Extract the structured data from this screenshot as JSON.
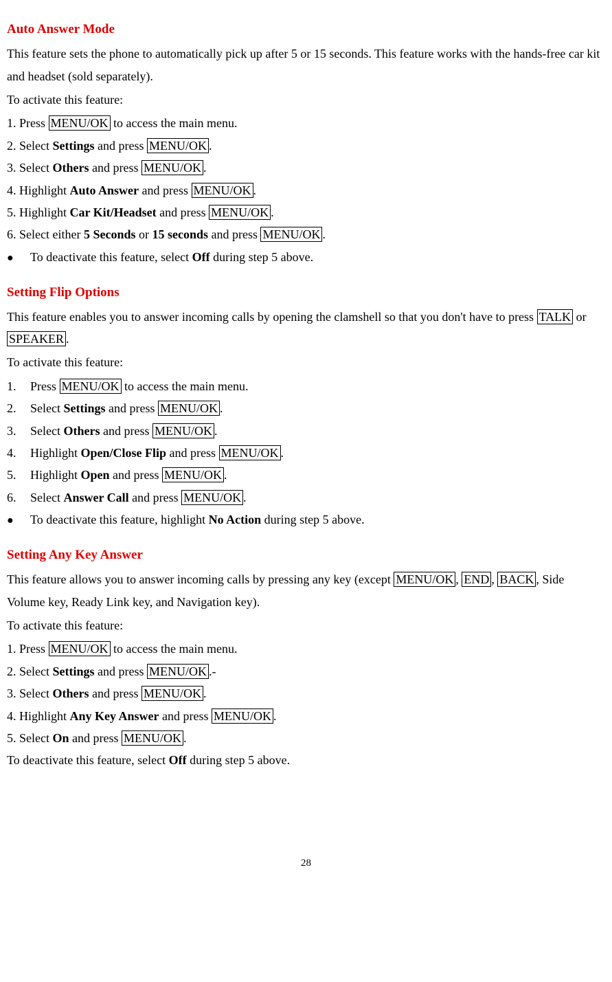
{
  "section1": {
    "heading": "Auto Answer Mode",
    "intro": "This feature sets the phone to automatically pick up after 5 or 15 seconds. This feature works with the hands-free car kit and headset (sold separately).",
    "activate": "To activate this feature:",
    "step1_pre": "1. Press ",
    "step1_key": "MENU/OK",
    "step1_post": " to access the main menu.",
    "step2_pre": "2. Select ",
    "step2_bold": "Settings",
    "step2_mid": " and press ",
    "step2_key": "MENU/OK",
    "step2_post": ".",
    "step3_pre": "3. Select ",
    "step3_bold": "Others",
    "step3_mid": " and press ",
    "step3_key": "MENU/OK",
    "step3_post": ".",
    "step4_pre": "4. Highlight ",
    "step4_bold": "Auto Answer",
    "step4_mid": " and press ",
    "step4_key": "MENU/OK",
    "step4_post": ".",
    "step5_pre": "5. Highlight ",
    "step5_bold": "Car Kit/Headset",
    "step5_mid": " and press ",
    "step5_key": "MENU/OK",
    "step5_post": ".",
    "step6_pre": "6. Select either ",
    "step6_bold1": "5 Seconds",
    "step6_mid1": " or ",
    "step6_bold2": "15 seconds",
    "step6_mid2": " and press ",
    "step6_key": "MENU/OK",
    "step6_post": ".",
    "bullet_pre": "To deactivate this feature, select ",
    "bullet_bold": "Off",
    "bullet_post": " during step 5 above."
  },
  "section2": {
    "heading": "Setting Flip Options",
    "intro_pre": "This feature enables you to answer incoming calls by opening the clamshell so that you don't have to press ",
    "intro_key1": "TALK",
    "intro_mid": " or ",
    "intro_key2": "SPEAKER",
    "intro_post": ".",
    "activate": "To activate this feature:",
    "step1_num": "1.",
    "step1_pre": "Press ",
    "step1_key": "MENU/OK",
    "step1_post": " to access the main menu.",
    "step2_num": "2.",
    "step2_pre": "Select ",
    "step2_bold": "Settings",
    "step2_mid": " and press ",
    "step2_key": "MENU/OK",
    "step2_post": ".",
    "step3_num": "3.",
    "step3_pre": "Select ",
    "step3_bold": "Others",
    "step3_mid": " and press ",
    "step3_key": "MENU/OK",
    "step3_post": ".",
    "step4_num": "4.",
    "step4_pre": "Highlight ",
    "step4_bold": "Open/Close Flip",
    "step4_mid": " and press ",
    "step4_key": "MENU/OK",
    "step4_post": ".",
    "step5_num": "5.",
    "step5_pre": "Highlight ",
    "step5_bold": "Open",
    "step5_mid": " and press ",
    "step5_key": "MENU/OK",
    "step5_post": ".",
    "step6_num": "6.",
    "step6_pre": "Select ",
    "step6_bold": "Answer Call",
    "step6_mid": " and press ",
    "step6_key": "MENU/OK",
    "step6_post": ".",
    "bullet_pre": "To deactivate this feature, highlight ",
    "bullet_bold": "No Action",
    "bullet_post": " during step 5 above."
  },
  "section3": {
    "heading": "Setting Any Key Answer",
    "intro_pre": "This feature allows you to answer incoming calls by pressing any key (except ",
    "intro_key1": "MENU/OK",
    "intro_mid1": ", ",
    "intro_key2": "END",
    "intro_mid2": ", ",
    "intro_key3": "BACK",
    "intro_post": ", Side Volume key, Ready Link key, and Navigation key).",
    "activate": "To activate this feature:",
    "step1_pre": "1. Press ",
    "step1_key": "MENU/OK",
    "step1_post": " to access the main menu.",
    "step2_pre": "2. Select ",
    "step2_bold": "Settings",
    "step2_mid": " and press ",
    "step2_key": "MENU/OK",
    "step2_post": ".-",
    "step3_pre": "3. Select ",
    "step3_bold": "Others",
    "step3_mid": " and press ",
    "step3_key": "MENU/OK",
    "step3_post": ".",
    "step4_pre": "4. Highlight ",
    "step4_bold": "Any Key Answer",
    "step4_mid": " and press ",
    "step4_key": "MENU/OK",
    "step4_post": ".",
    "step5_pre": "5. Select ",
    "step5_bold": "On",
    "step5_mid": " and press ",
    "step5_key": "MENU/OK",
    "step5_post": ".",
    "deactivate_pre": "To deactivate this feature, select ",
    "deactivate_bold": "Off",
    "deactivate_post": " during step 5 above."
  },
  "page_number": "28"
}
